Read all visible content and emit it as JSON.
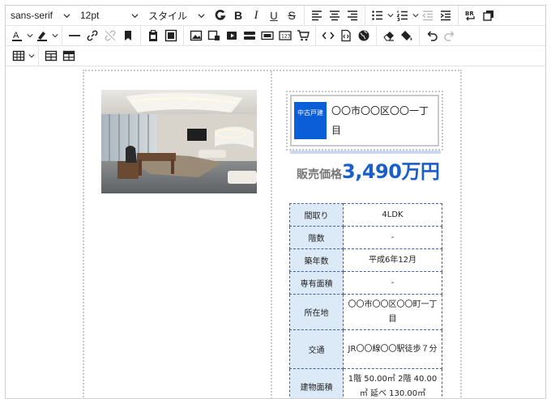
{
  "toolbar": {
    "font_family": "sans-serif",
    "font_size": "12pt",
    "style": "スタイル",
    "bold": "B",
    "bold_heavy": "B",
    "italic": "I",
    "underline": "U",
    "strike": "S",
    "text_color_letter": "A"
  },
  "property": {
    "badge": "中古戸建",
    "title": "〇〇市〇〇区〇〇一丁目",
    "price_label": "販売価格",
    "price_value": "3,490万円",
    "specs": [
      {
        "key": "間取り",
        "value": "4LDK"
      },
      {
        "key": "階数",
        "value": "-"
      },
      {
        "key": "築年数",
        "value": "平成6年12月"
      },
      {
        "key": "専有面積",
        "value": "-"
      },
      {
        "key": "所在地",
        "value": "〇〇市〇〇区〇〇町一丁目"
      },
      {
        "key": "交通",
        "value": "JR〇〇線〇〇駅徒歩７分"
      },
      {
        "key": "建物面積",
        "value": "1階 50.00㎡ 2階 40.00㎡ 延べ 130.00㎡"
      }
    ]
  },
  "colors": {
    "accent": "#1a5ec9",
    "badge_bg": "#0b5ed7",
    "spec_key_bg": "#dce9f7",
    "spec_border": "#3c62a8"
  }
}
